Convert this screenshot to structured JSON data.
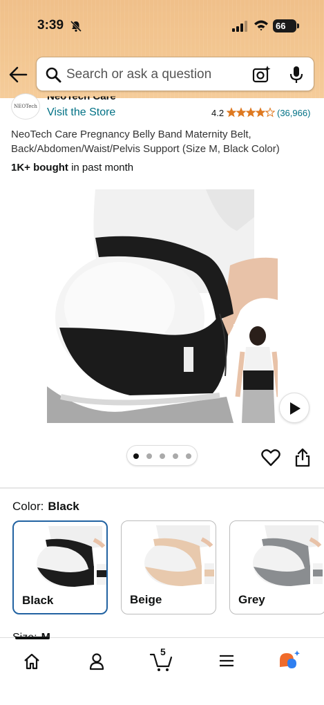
{
  "status_bar": {
    "time": "3:39",
    "battery": "66"
  },
  "search": {
    "placeholder": "Search or ask a question"
  },
  "brand": {
    "name": "NeoTech Care",
    "logo_text": "NEOTech",
    "visit_store": "Visit the Store"
  },
  "rating": {
    "value": "4.2",
    "stars": 4.2,
    "count": "(36,966)"
  },
  "product": {
    "title": "NeoTech Care Pregnancy Belly Band Maternity Belt, Back/Abdomen/Waist/Pelvis Support (Size M, Black Color)",
    "bought_bold": "1K+ bought",
    "bought_rest": " in past month",
    "image_count": 5,
    "image_index": 1
  },
  "color": {
    "label": "Color:",
    "selected": "Black",
    "options": [
      {
        "name": "Black",
        "band_color": "#1c1c1c"
      },
      {
        "name": "Beige",
        "band_color": "#e8c9ad"
      },
      {
        "name": "Grey",
        "band_color": "#8a8d90"
      }
    ]
  },
  "size": {
    "label": "Size:",
    "value": "M"
  },
  "cart": {
    "count": "5"
  },
  "colors": {
    "link": "#007185",
    "star": "#de7921",
    "selected_border": "#2162a1"
  },
  "icons": [
    "back-arrow-icon",
    "search-icon",
    "camera-icon",
    "mic-icon",
    "heart-icon",
    "share-icon",
    "play-icon",
    "home-icon",
    "account-icon",
    "cart-icon",
    "menu-icon",
    "rufus-icon"
  ]
}
